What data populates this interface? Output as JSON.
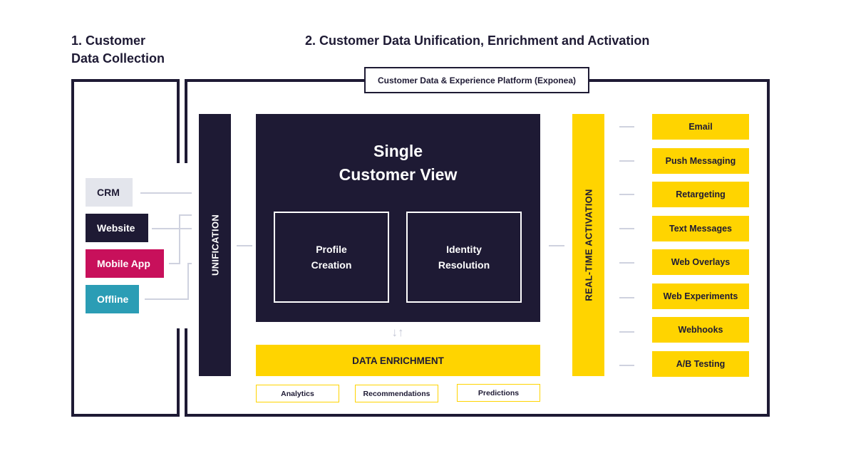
{
  "headings": {
    "collection_line1": "1. Customer",
    "collection_line2": "Data Collection",
    "unification": "2. Customer Data Unification, Enrichment and Activation"
  },
  "platform_label": "Customer Data & Experience Platform (Exponea)",
  "sources": [
    {
      "label": "CRM",
      "bg": "#e3e5ec",
      "fg": "#1e1a34"
    },
    {
      "label": "Website",
      "bg": "#1e1a34",
      "fg": "#ffffff"
    },
    {
      "label": "Mobile App",
      "bg": "#c8105b",
      "fg": "#ffffff"
    },
    {
      "label": "Offline",
      "bg": "#2b9db5",
      "fg": "#ffffff"
    }
  ],
  "unification_label": "UNIFICATION",
  "scv": {
    "title_line1": "Single",
    "title_line2": "Customer View",
    "boxes": [
      {
        "line1": "Profile",
        "line2": "Creation"
      },
      {
        "line1": "Identity",
        "line2": "Resolution"
      }
    ]
  },
  "enrichment": {
    "arrows": "↓↑",
    "label": "DATA ENRICHMENT",
    "items": [
      "Analytics",
      "Recommendations",
      "Predictions"
    ]
  },
  "activation_label": "REAL-TIME ACTIVATION",
  "outputs": [
    "Email",
    "Push Messaging",
    "Retargeting",
    "Text Messages",
    "Web Overlays",
    "Web Experiments",
    "Webhooks",
    "A/B Testing"
  ],
  "colors": {
    "navy": "#1e1a34",
    "yellow": "#ffd400",
    "connector": "#cfd2df"
  }
}
